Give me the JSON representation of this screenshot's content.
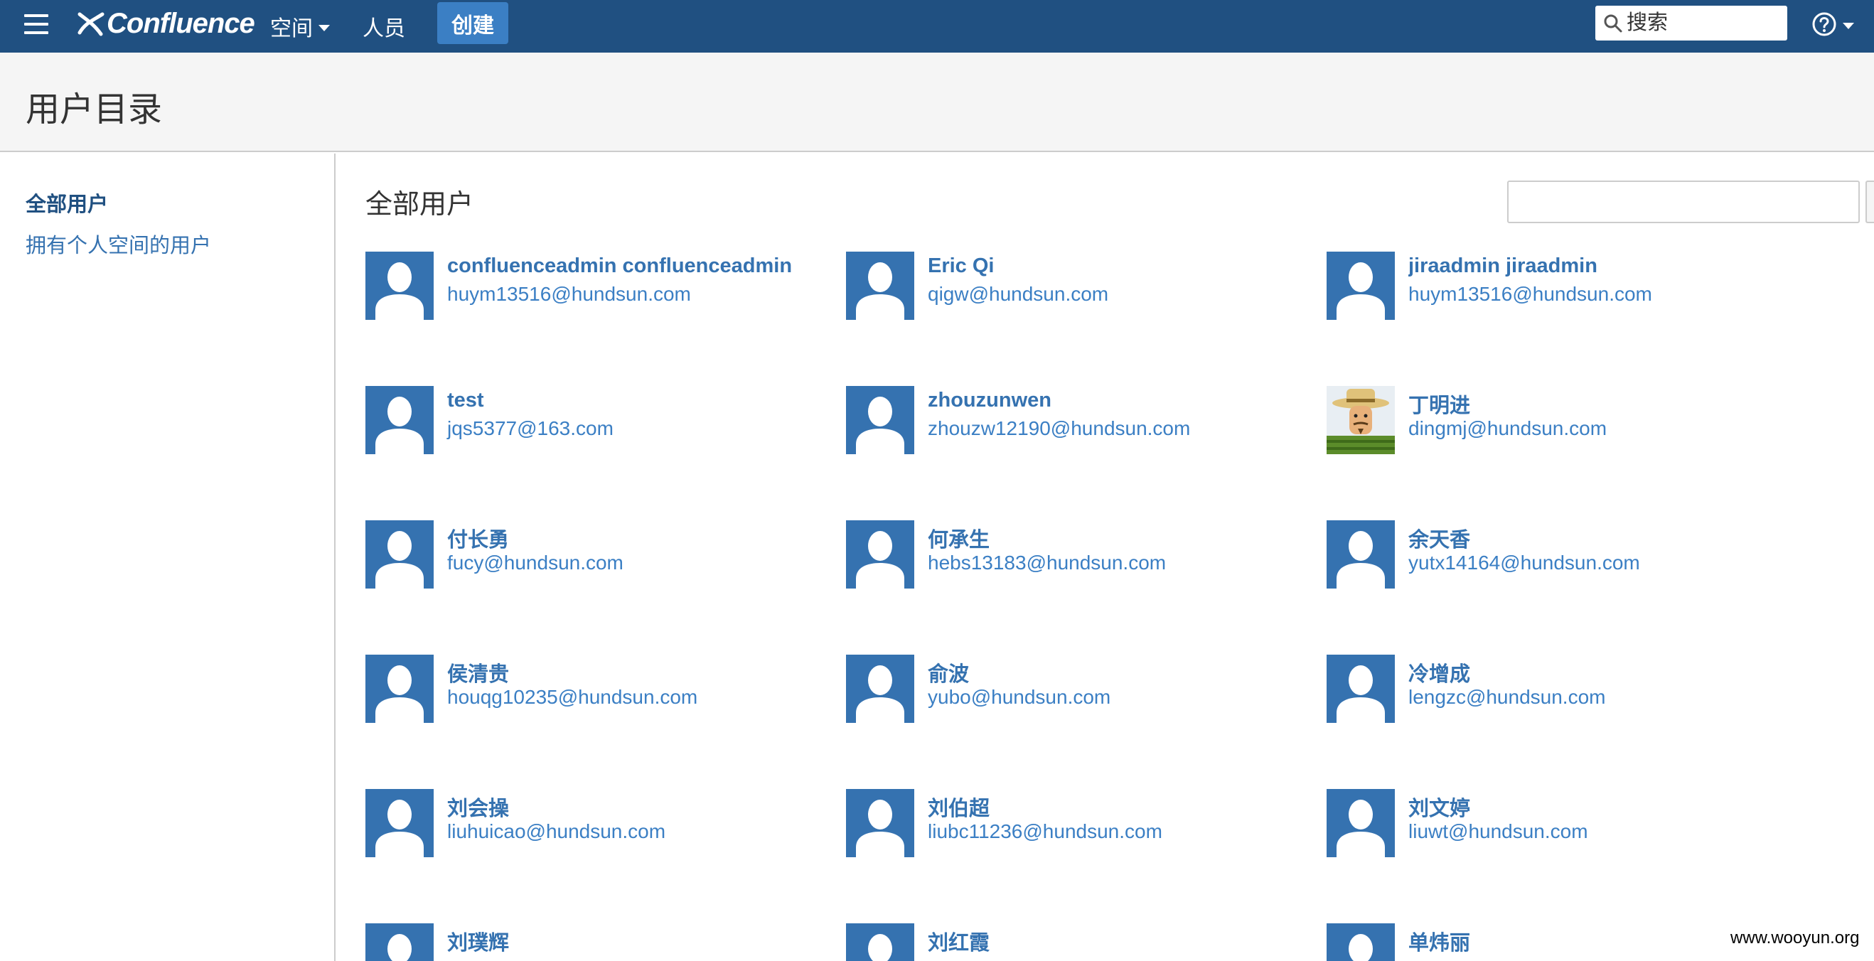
{
  "topbar": {
    "brand": "Confluence",
    "nav_spaces": "空间",
    "nav_people": "人员",
    "create_label": "创建",
    "search_placeholder": "搜索",
    "bg_color": "#205081",
    "create_color": "#3b7fc4"
  },
  "page": {
    "title": "用户目录"
  },
  "sidebar": {
    "items": [
      {
        "label": "全部用户",
        "active": true
      },
      {
        "label": "拥有个人空间的用户",
        "active": false
      }
    ]
  },
  "main": {
    "section_title": "全部用户",
    "filter_value": "",
    "users": [
      {
        "name": "confluenceadmin confluenceadmin",
        "email": "huym13516@hundsun.com",
        "avatar": "default-avatar-icon"
      },
      {
        "name": "Eric Qi",
        "email": "qigw@hundsun.com",
        "avatar": "default-avatar-icon"
      },
      {
        "name": "jiraadmin jiraadmin",
        "email": "huym13516@hundsun.com",
        "avatar": "default-avatar-icon"
      },
      {
        "name": "test",
        "email": "jqs5377@163.com",
        "avatar": "default-avatar-icon"
      },
      {
        "name": "zhouzunwen",
        "email": "zhouzw12190@hundsun.com",
        "avatar": "default-avatar-icon"
      },
      {
        "name": "丁明进",
        "email": "dingmj@hundsun.com",
        "avatar": "cartoon-man-avatar-icon"
      },
      {
        "name": "付长勇",
        "email": "fucy@hundsun.com",
        "avatar": "default-avatar-icon"
      },
      {
        "name": "何承生",
        "email": "hebs13183@hundsun.com",
        "avatar": "default-avatar-icon"
      },
      {
        "name": "余天香",
        "email": "yutx14164@hundsun.com",
        "avatar": "default-avatar-icon"
      },
      {
        "name": "侯清贵",
        "email": "houqg10235@hundsun.com",
        "avatar": "default-avatar-icon"
      },
      {
        "name": "俞波",
        "email": "yubo@hundsun.com",
        "avatar": "default-avatar-icon"
      },
      {
        "name": "冷增成",
        "email": "lengzc@hundsun.com",
        "avatar": "default-avatar-icon"
      },
      {
        "name": "刘会操",
        "email": "liuhuicao@hundsun.com",
        "avatar": "default-avatar-icon"
      },
      {
        "name": "刘伯超",
        "email": "liubc11236@hundsun.com",
        "avatar": "default-avatar-icon"
      },
      {
        "name": "刘文婷",
        "email": "liuwt@hundsun.com",
        "avatar": "default-avatar-icon"
      },
      {
        "name": "刘璞辉",
        "email": "",
        "avatar": "default-avatar-icon"
      },
      {
        "name": "刘红霞",
        "email": "",
        "avatar": "default-avatar-icon"
      },
      {
        "name": "单炜丽",
        "email": "",
        "avatar": "default-avatar-icon"
      }
    ]
  },
  "watermark": "www.wooyun.org"
}
